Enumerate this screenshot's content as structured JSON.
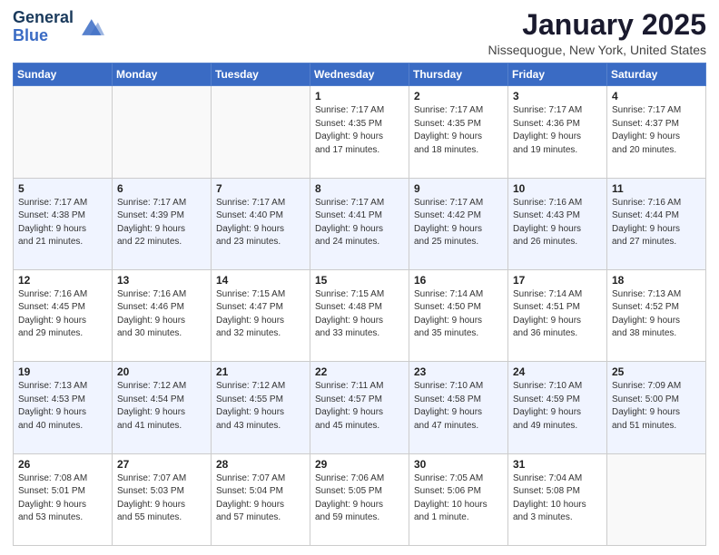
{
  "header": {
    "logo_line1": "General",
    "logo_line2": "Blue",
    "month": "January 2025",
    "location": "Nissequogue, New York, United States"
  },
  "days_of_week": [
    "Sunday",
    "Monday",
    "Tuesday",
    "Wednesday",
    "Thursday",
    "Friday",
    "Saturday"
  ],
  "weeks": [
    [
      {
        "day": "",
        "info": ""
      },
      {
        "day": "",
        "info": ""
      },
      {
        "day": "",
        "info": ""
      },
      {
        "day": "1",
        "info": "Sunrise: 7:17 AM\nSunset: 4:35 PM\nDaylight: 9 hours\nand 17 minutes."
      },
      {
        "day": "2",
        "info": "Sunrise: 7:17 AM\nSunset: 4:35 PM\nDaylight: 9 hours\nand 18 minutes."
      },
      {
        "day": "3",
        "info": "Sunrise: 7:17 AM\nSunset: 4:36 PM\nDaylight: 9 hours\nand 19 minutes."
      },
      {
        "day": "4",
        "info": "Sunrise: 7:17 AM\nSunset: 4:37 PM\nDaylight: 9 hours\nand 20 minutes."
      }
    ],
    [
      {
        "day": "5",
        "info": "Sunrise: 7:17 AM\nSunset: 4:38 PM\nDaylight: 9 hours\nand 21 minutes."
      },
      {
        "day": "6",
        "info": "Sunrise: 7:17 AM\nSunset: 4:39 PM\nDaylight: 9 hours\nand 22 minutes."
      },
      {
        "day": "7",
        "info": "Sunrise: 7:17 AM\nSunset: 4:40 PM\nDaylight: 9 hours\nand 23 minutes."
      },
      {
        "day": "8",
        "info": "Sunrise: 7:17 AM\nSunset: 4:41 PM\nDaylight: 9 hours\nand 24 minutes."
      },
      {
        "day": "9",
        "info": "Sunrise: 7:17 AM\nSunset: 4:42 PM\nDaylight: 9 hours\nand 25 minutes."
      },
      {
        "day": "10",
        "info": "Sunrise: 7:16 AM\nSunset: 4:43 PM\nDaylight: 9 hours\nand 26 minutes."
      },
      {
        "day": "11",
        "info": "Sunrise: 7:16 AM\nSunset: 4:44 PM\nDaylight: 9 hours\nand 27 minutes."
      }
    ],
    [
      {
        "day": "12",
        "info": "Sunrise: 7:16 AM\nSunset: 4:45 PM\nDaylight: 9 hours\nand 29 minutes."
      },
      {
        "day": "13",
        "info": "Sunrise: 7:16 AM\nSunset: 4:46 PM\nDaylight: 9 hours\nand 30 minutes."
      },
      {
        "day": "14",
        "info": "Sunrise: 7:15 AM\nSunset: 4:47 PM\nDaylight: 9 hours\nand 32 minutes."
      },
      {
        "day": "15",
        "info": "Sunrise: 7:15 AM\nSunset: 4:48 PM\nDaylight: 9 hours\nand 33 minutes."
      },
      {
        "day": "16",
        "info": "Sunrise: 7:14 AM\nSunset: 4:50 PM\nDaylight: 9 hours\nand 35 minutes."
      },
      {
        "day": "17",
        "info": "Sunrise: 7:14 AM\nSunset: 4:51 PM\nDaylight: 9 hours\nand 36 minutes."
      },
      {
        "day": "18",
        "info": "Sunrise: 7:13 AM\nSunset: 4:52 PM\nDaylight: 9 hours\nand 38 minutes."
      }
    ],
    [
      {
        "day": "19",
        "info": "Sunrise: 7:13 AM\nSunset: 4:53 PM\nDaylight: 9 hours\nand 40 minutes."
      },
      {
        "day": "20",
        "info": "Sunrise: 7:12 AM\nSunset: 4:54 PM\nDaylight: 9 hours\nand 41 minutes."
      },
      {
        "day": "21",
        "info": "Sunrise: 7:12 AM\nSunset: 4:55 PM\nDaylight: 9 hours\nand 43 minutes."
      },
      {
        "day": "22",
        "info": "Sunrise: 7:11 AM\nSunset: 4:57 PM\nDaylight: 9 hours\nand 45 minutes."
      },
      {
        "day": "23",
        "info": "Sunrise: 7:10 AM\nSunset: 4:58 PM\nDaylight: 9 hours\nand 47 minutes."
      },
      {
        "day": "24",
        "info": "Sunrise: 7:10 AM\nSunset: 4:59 PM\nDaylight: 9 hours\nand 49 minutes."
      },
      {
        "day": "25",
        "info": "Sunrise: 7:09 AM\nSunset: 5:00 PM\nDaylight: 9 hours\nand 51 minutes."
      }
    ],
    [
      {
        "day": "26",
        "info": "Sunrise: 7:08 AM\nSunset: 5:01 PM\nDaylight: 9 hours\nand 53 minutes."
      },
      {
        "day": "27",
        "info": "Sunrise: 7:07 AM\nSunset: 5:03 PM\nDaylight: 9 hours\nand 55 minutes."
      },
      {
        "day": "28",
        "info": "Sunrise: 7:07 AM\nSunset: 5:04 PM\nDaylight: 9 hours\nand 57 minutes."
      },
      {
        "day": "29",
        "info": "Sunrise: 7:06 AM\nSunset: 5:05 PM\nDaylight: 9 hours\nand 59 minutes."
      },
      {
        "day": "30",
        "info": "Sunrise: 7:05 AM\nSunset: 5:06 PM\nDaylight: 10 hours\nand 1 minute."
      },
      {
        "day": "31",
        "info": "Sunrise: 7:04 AM\nSunset: 5:08 PM\nDaylight: 10 hours\nand 3 minutes."
      },
      {
        "day": "",
        "info": ""
      }
    ]
  ]
}
